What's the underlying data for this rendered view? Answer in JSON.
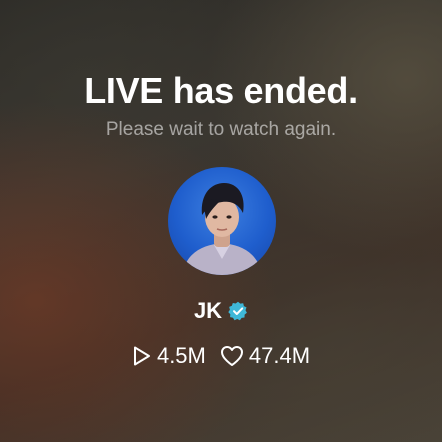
{
  "live": {
    "title": "LIVE has ended.",
    "subtitle": "Please wait to watch again."
  },
  "artist": {
    "name": "JK",
    "verified": true,
    "avatar_background": "#1f5ecd"
  },
  "stats": {
    "plays": "4.5M",
    "likes": "47.4M"
  },
  "icons": {
    "verified": "verified-badge-icon",
    "plays": "play-icon",
    "likes": "heart-icon"
  },
  "colors": {
    "verified_badge": "#3fb8d8",
    "text_primary": "#ffffff",
    "text_secondary": "#a8a49c"
  }
}
